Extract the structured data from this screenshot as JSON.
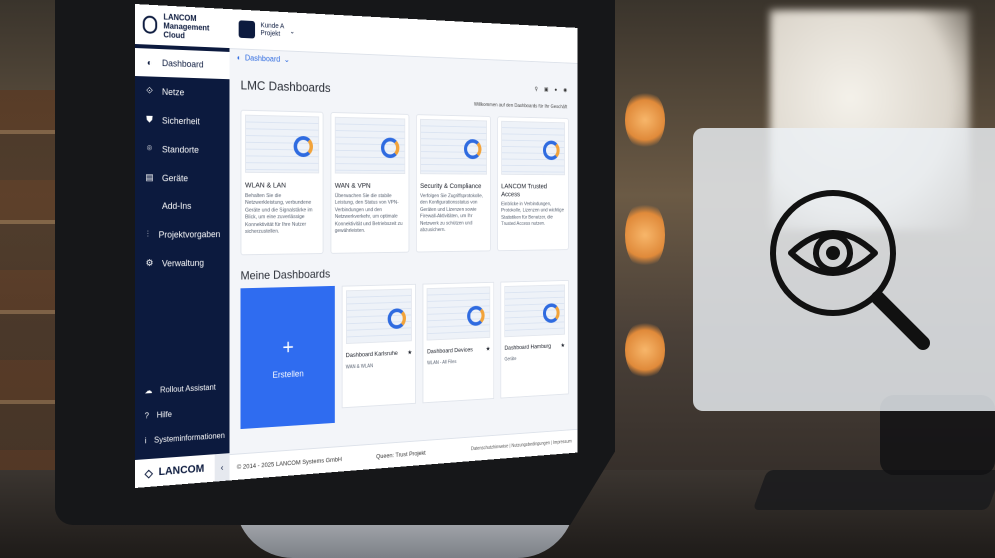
{
  "app": {
    "logo_text": "LANCOM Management Cloud",
    "project_label": "Kunde A",
    "project_sub": "Projekt"
  },
  "breadcrumb": "Dashboard",
  "sidebar": {
    "items": [
      {
        "icon": "dashboard-icon",
        "label": "Dashboard"
      },
      {
        "icon": "network-icon",
        "label": "Netze"
      },
      {
        "icon": "shield-icon",
        "label": "Sicherheit"
      },
      {
        "icon": "location-icon",
        "label": "Standorte"
      },
      {
        "icon": "devices-icon",
        "label": "Geräte"
      },
      {
        "icon": "code-icon",
        "label": "Add-Ins"
      },
      {
        "icon": "sliders-icon",
        "label": "Projektvorgaben"
      },
      {
        "icon": "gears-icon",
        "label": "Verwaltung"
      }
    ],
    "bottom_items": [
      {
        "icon": "rollout-icon",
        "label": "Rollout Assistant"
      },
      {
        "icon": "help-icon",
        "label": "Hilfe"
      },
      {
        "icon": "info-icon",
        "label": "Systeminformationen"
      }
    ],
    "brand": "LANCOM"
  },
  "main": {
    "title": "LMC Dashboards",
    "welcome": "Willkommen auf den Dashboards für Ihr Geschäft",
    "cards": [
      {
        "title": "WLAN & LAN",
        "desc": "Behalten Sie die Netzwerkleistung, verbundene Geräte und die Signalstärke im Blick, um eine zuverlässige Konnektivität für Ihre Nutzer sicherzustellen."
      },
      {
        "title": "WAN & VPN",
        "desc": "Überwachen Sie die stabile Leistung, den Status von VPN-Verbindungen und den Netzwerkverkehr, um optimale Konnektivität und Betriebszeit zu gewährleisten."
      },
      {
        "title": "Security & Compliance",
        "desc": "Verfolgen Sie Zugriffsprotokolle, den Konfigurationsstatus von Geräten und Lizenzen sowie Firewall-Aktivitäten, um Ihr Netzwerk zu schützen und abzusichern."
      },
      {
        "title": "LANCOM Trusted Access",
        "desc": "Einblicke in Verbindungen, Protokolle, Lizenzen und wichtige Statistiken für Benutzer, die Trusted Access nutzen."
      }
    ],
    "mine_title": "Meine Dashboards",
    "create_label": "Erstellen",
    "mine": [
      {
        "title": "Dashboard Karlsruhe",
        "sub": "WAN & WLAN"
      },
      {
        "title": "Dashboard Devices",
        "sub": "WLAN - All Files"
      },
      {
        "title": "Dashboard Hamburg",
        "sub": "Geräte"
      }
    ]
  },
  "footer": {
    "copyright": "© 2014 - 2025 LANCOM Systems GmbH",
    "center": "Queen: Trust Projekt",
    "links": "Datenschutzhinweise | Nutzungsbedingungen | Impressum"
  },
  "colors": {
    "sidebar": "#0c1a3e",
    "accent": "#2f6cf0"
  }
}
